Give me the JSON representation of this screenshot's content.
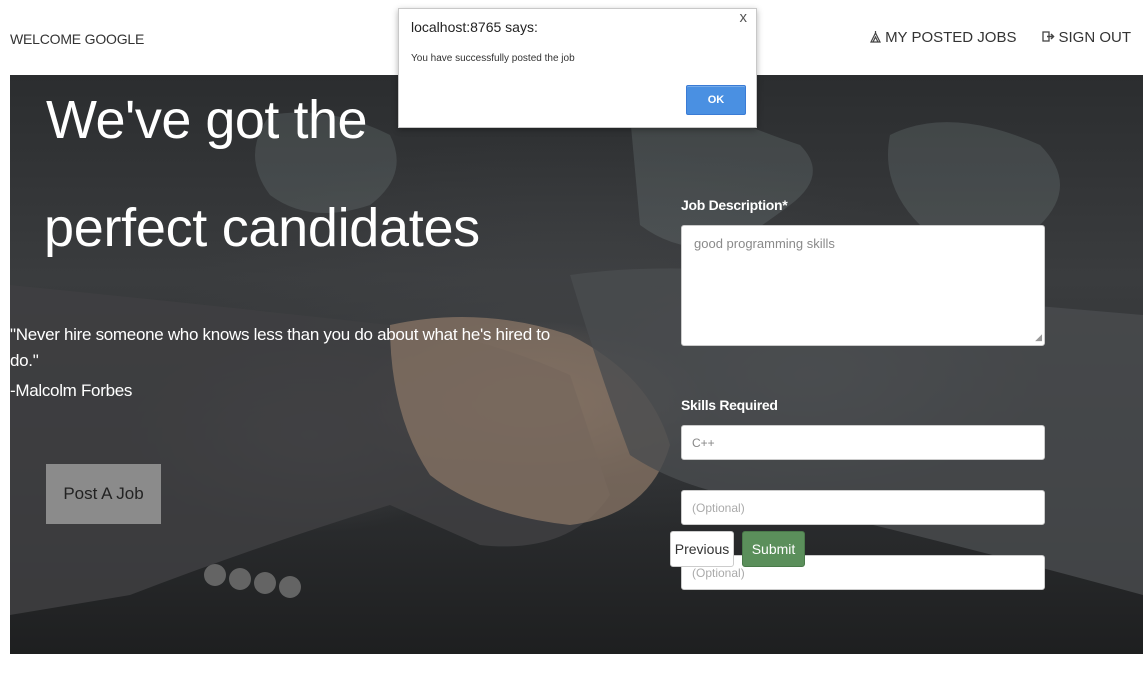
{
  "nav": {
    "welcome": "WELCOME GOOGLE",
    "my_posted_jobs": "MY POSTED JOBS",
    "my_posted_jobs_icon": "briefcase-icon",
    "sign_out": "SIGN OUT",
    "sign_out_icon": "sign-out-icon"
  },
  "hero": {
    "title_line1": "We've got the",
    "title_line2": "perfect candidates",
    "quote": "\"Never hire someone who knows less than you do about what he's hired to do.\"",
    "quote_author": "-Malcolm Forbes",
    "post_job_button": "Post A Job"
  },
  "form": {
    "job_description_label": "Job Description*",
    "job_description_value": "good programming skills",
    "skills_label": "Skills Required",
    "skill1_value": "C++",
    "skill2_placeholder": "(Optional)",
    "skill3_placeholder": "(Optional)",
    "previous_button": "Previous",
    "submit_button": "Submit"
  },
  "dialog": {
    "title": "localhost:8765 says:",
    "message": "You have successfully posted the job",
    "ok_button": "OK",
    "close": "x"
  },
  "colors": {
    "submit": "#5b8f5b",
    "ok_button": "#4a90e2",
    "post_job_button": "#8b8b8b"
  }
}
